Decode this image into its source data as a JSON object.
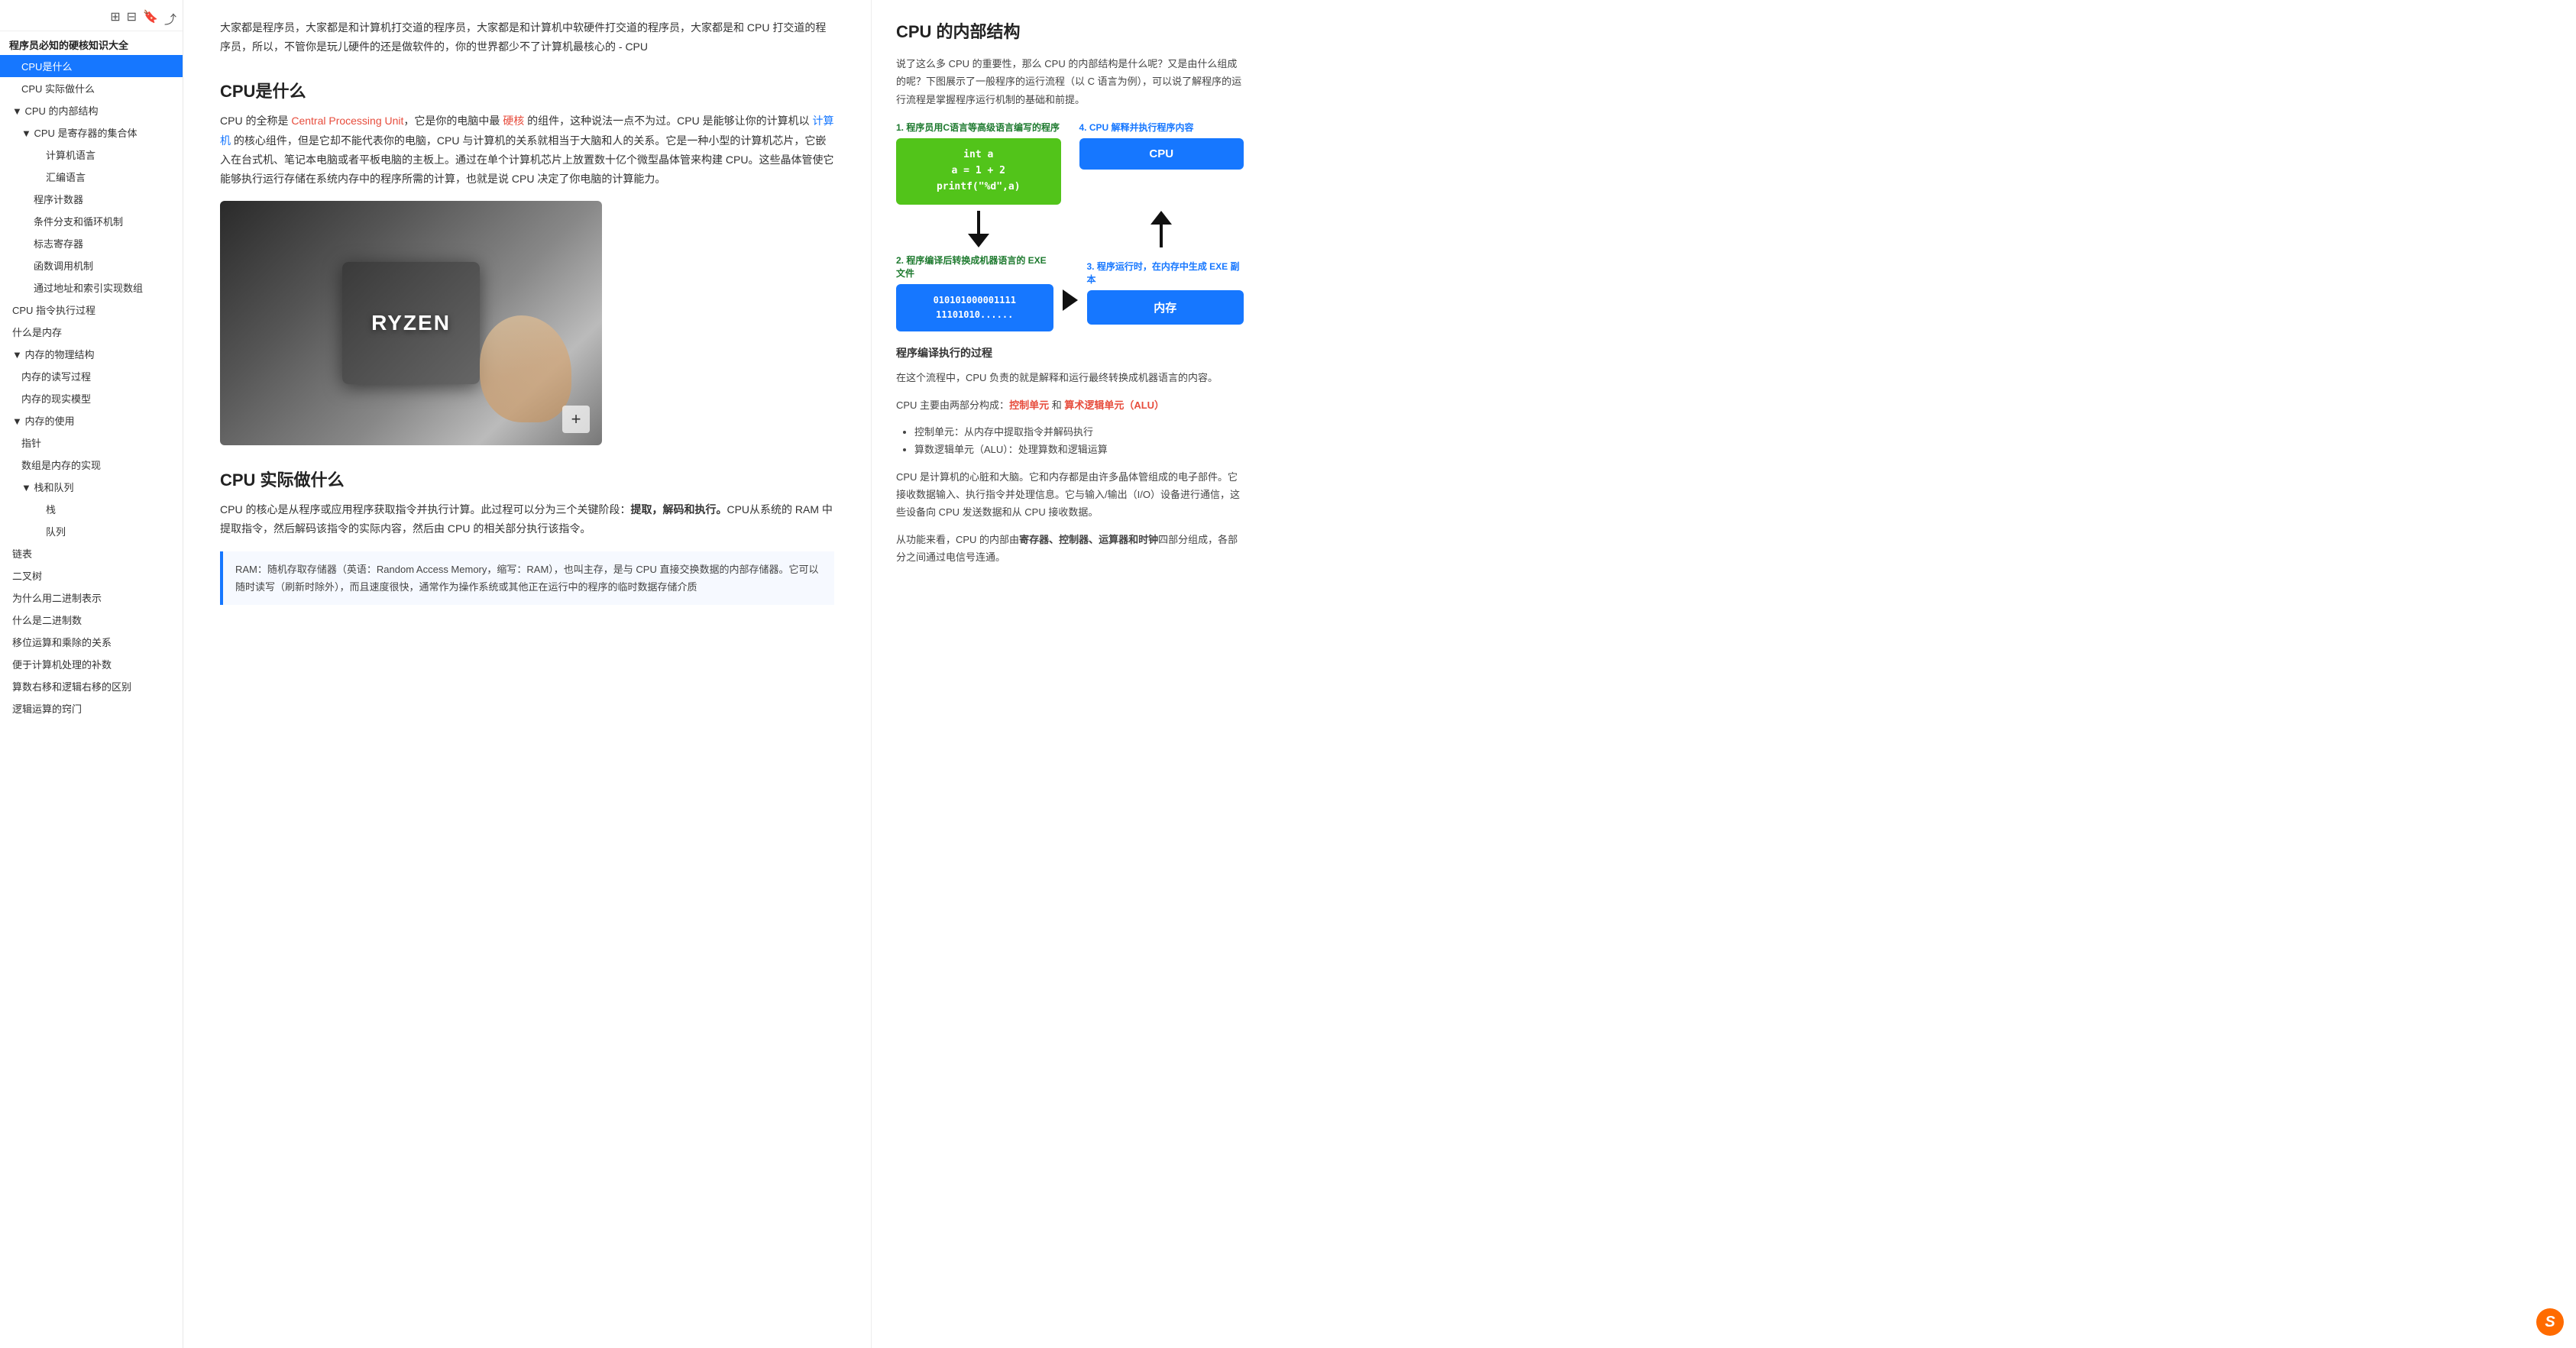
{
  "sidebar": {
    "top_icons": [
      "grid-icon",
      "grid2-icon",
      "bookmark-icon",
      "share-icon"
    ],
    "root_item": "程序员必知的硬核知识大全",
    "items": [
      {
        "id": "cpu-what",
        "label": "CPU是什么",
        "indent": 1,
        "active": true
      },
      {
        "id": "cpu-do",
        "label": "CPU 实际做什么",
        "indent": 1,
        "active": false
      },
      {
        "id": "cpu-internal",
        "label": "CPU 的内部结构",
        "indent": 0,
        "active": false,
        "collapsible": true,
        "collapsed": false
      },
      {
        "id": "cpu-registers",
        "label": "CPU 是寄存器的集合体",
        "indent": 1,
        "active": false,
        "collapsible": true,
        "collapsed": false
      },
      {
        "id": "machine-lang",
        "label": "计算机语言",
        "indent": 3,
        "active": false
      },
      {
        "id": "asm-lang",
        "label": "汇编语言",
        "indent": 3,
        "active": false
      },
      {
        "id": "prog-counter",
        "label": "程序计数器",
        "indent": 2,
        "active": false
      },
      {
        "id": "branch",
        "label": "条件分支和循环机制",
        "indent": 2,
        "active": false
      },
      {
        "id": "flag-reg",
        "label": "标志寄存器",
        "indent": 2,
        "active": false
      },
      {
        "id": "func-call",
        "label": "函数调用机制",
        "indent": 2,
        "active": false
      },
      {
        "id": "addr-array",
        "label": "通过地址和索引实现数组",
        "indent": 2,
        "active": false
      },
      {
        "id": "cpu-exec",
        "label": "CPU 指令执行过程",
        "indent": 0,
        "active": false
      },
      {
        "id": "what-is-mem",
        "label": "什么是内存",
        "indent": 0,
        "active": false
      },
      {
        "id": "mem-physical",
        "label": "内存的物理结构",
        "indent": 0,
        "active": false,
        "collapsible": true,
        "collapsed": false
      },
      {
        "id": "mem-rw",
        "label": "内存的读写过程",
        "indent": 1,
        "active": false
      },
      {
        "id": "mem-real",
        "label": "内存的现实模型",
        "indent": 1,
        "active": false
      },
      {
        "id": "mem-use",
        "label": "内存的使用",
        "indent": 0,
        "active": false,
        "collapsible": true,
        "collapsed": false
      },
      {
        "id": "pointer",
        "label": "指针",
        "indent": 1,
        "active": false
      },
      {
        "id": "array-mem",
        "label": "数组是内存的实现",
        "indent": 1,
        "active": false
      },
      {
        "id": "stack-queue",
        "label": "栈和队列",
        "indent": 1,
        "active": false,
        "collapsible": true,
        "collapsed": false
      },
      {
        "id": "stack",
        "label": "栈",
        "indent": 3,
        "active": false
      },
      {
        "id": "queue",
        "label": "队列",
        "indent": 3,
        "active": false
      },
      {
        "id": "linked-list",
        "label": "链表",
        "indent": 0,
        "active": false
      },
      {
        "id": "binary-tree",
        "label": "二叉树",
        "indent": 0,
        "active": false
      },
      {
        "id": "why-binary",
        "label": "为什么用二进制表示",
        "indent": 0,
        "active": false
      },
      {
        "id": "what-binary",
        "label": "什么是二进制数",
        "indent": 0,
        "active": false
      },
      {
        "id": "shift-div",
        "label": "移位运算和乘除的关系",
        "indent": 0,
        "active": false
      },
      {
        "id": "complement",
        "label": "便于计算机处理的补数",
        "indent": 0,
        "active": false
      },
      {
        "id": "arith-logic",
        "label": "算数右移和逻辑右移的区别",
        "indent": 0,
        "active": false
      },
      {
        "id": "logic-door",
        "label": "逻辑运算的窍门",
        "indent": 0,
        "active": false
      }
    ]
  },
  "main": {
    "intro_text": "大家都是程序员，大家都是和计算机打交道的程序员，大家都是和计算机中软硬件打交道的程序员，大家都是和 CPU 打交道的程序员，所以，不管你是玩儿硬件的还是做软件的，你的世界都少不了计算机最核心的 - CPU",
    "section1_title": "CPU是什么",
    "section1_p1_before": "CPU 的全称是 ",
    "section1_p1_highlight": "Central Processing Unit",
    "section1_p1_after": "，它是你的电脑中最 ",
    "section1_p1_highlight2": "硬核",
    "section1_p1_after2": " 的组件，这种说法一点不为过。CPU 是能够让你的计算机以 ",
    "section1_p1_highlight3": "计算机",
    "section1_p1_after3": " 的核心组件，但是它却不能代表你的电脑，CPU 与计算机的关系就相当于大脑和人的关系。它是一种小型的计算机芯片，它嵌入在台式机、笔记本电脑或者平板电脑的主板上。通过在单个计算机芯片上放置数十亿个微型晶体管来构建 CPU。这些晶体管使它能够执行运行存储在系统内存中的程序所需的计算，也就是说 CPU 决定了你电脑的计算能力。",
    "section2_title": "CPU 实际做什么",
    "section2_p1": "CPU 的核心是从程序或应用程序获取指令并执行计算。此过程可以分为三个关键阶段：",
    "section2_p1_highlight": "提取，解码和执行。",
    "section2_p1_after": "CPU从系统的 RAM 中提取指令，然后解码该指令的实际内容，然后由 CPU 的相关部分执行该指令。",
    "blockquote": "RAM：随机存取存储器（英语：Random Access Memory，缩写：RAM），也叫主存，是与 CPU 直接交换数据的内部存储器。它可以随时读写（刷新时除外），而且速度很快，通常作为操作系统或其他正在运行中的程序的临时数据存储介质"
  },
  "right_panel": {
    "title": "CPU 的内部结构",
    "intro": "说了这么多 CPU 的重要性，那么 CPU 的内部结构是什么呢？又是由什么组成的呢？下图展示了一般程序的运行流程（以 C 语言为例），可以说了解程序的运行流程是掌握程序运行机制的基础和前提。",
    "step1_label": "1. 程序员用C语言等高级语言编写的程序",
    "step1_code": "int a\na = 1 + 2\nprintf(\"%d\",a)",
    "step4_label": "4. CPU 解释并执行程序内容",
    "step4_box": "CPU",
    "step2_label": "2. 程序编译后转换成机器语言的 EXE 文件",
    "step2_code": "010101000001111\n11101010......",
    "step3_label": "3. 程序运行时，在内存中生成 EXE 副本",
    "step3_box": "内存",
    "process_title": "程序编译执行的过程",
    "process_p1": "在这个流程中，CPU 负责的就是解释和运行最终转换成机器语言的内容。",
    "components_p": "CPU 主要由两部分构成：",
    "ctrl_unit": "控制单元",
    "and_text": " 和 ",
    "alu": "算术逻辑单元（ALU）",
    "bullets": [
      "控制单元：从内存中提取指令并解码执行",
      "算数逻辑单元（ALU）：处理算数和逻辑运算"
    ],
    "summary_p1": "CPU 是计算机的心脏和大脑。它和内存都是由许多晶体管组成的电子部件。它接收数据输入、执行指令并处理信息。它与输入/输出（I/O）设备进行通信，这些设备向 CPU 发送数据和从 CPU 接收数据。",
    "summary_p2": "从功能来看，CPU 的内部由寄存器、控制器、运算器和时钟四部分组成，各部分之间通过电信号连通。",
    "highlight_registers": "寄存器、控制器、运算器和时钟"
  }
}
